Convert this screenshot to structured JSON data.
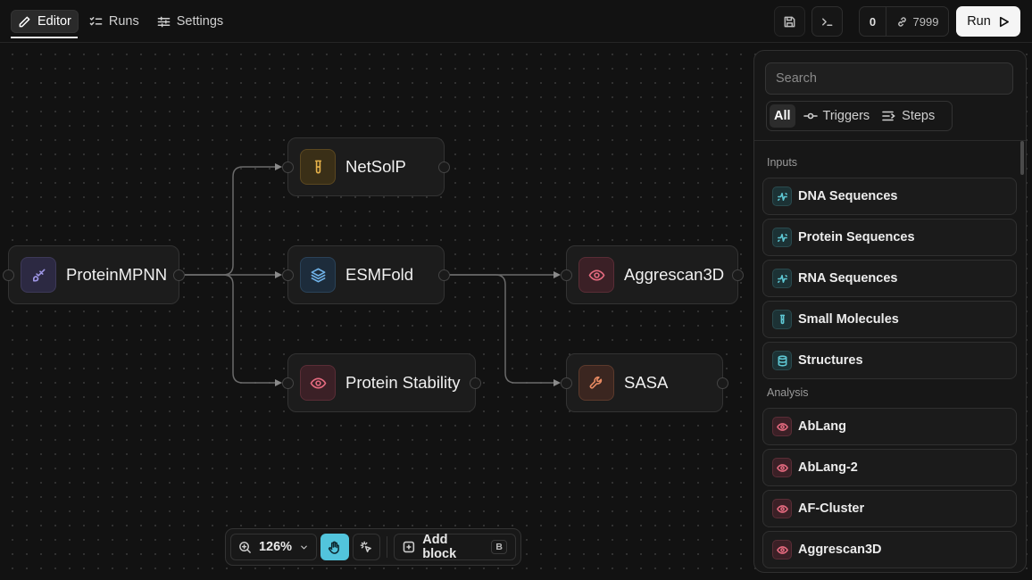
{
  "tabs": [
    {
      "label": "Editor",
      "active": true
    },
    {
      "label": "Runs",
      "active": false
    },
    {
      "label": "Settings",
      "active": false
    }
  ],
  "header": {
    "count": "0",
    "port": "7999",
    "run_label": "Run"
  },
  "nodes": {
    "proteinmpnn": "ProteinMPNN",
    "netsolp": "NetSolP",
    "esmfold": "ESMFold",
    "protein_stability": "Protein Stability",
    "aggrescan3d": "Aggrescan3D",
    "sasa": "SASA"
  },
  "toolbar": {
    "zoom": "126%",
    "add_block": "Add block",
    "add_block_shortcut": "B"
  },
  "panel": {
    "search_placeholder": "Search",
    "filters": [
      "All",
      "Triggers",
      "Steps"
    ],
    "sections": {
      "inputs": "Inputs",
      "analysis": "Analysis"
    },
    "inputs": [
      "DNA Sequences",
      "Protein Sequences",
      "RNA Sequences",
      "Small Molecules",
      "Structures"
    ],
    "analysis": [
      "AbLang",
      "AbLang-2",
      "AF-Cluster",
      "Aggrescan3D"
    ]
  },
  "colors": {
    "accent": "#52c4dc",
    "background": "#121212"
  }
}
